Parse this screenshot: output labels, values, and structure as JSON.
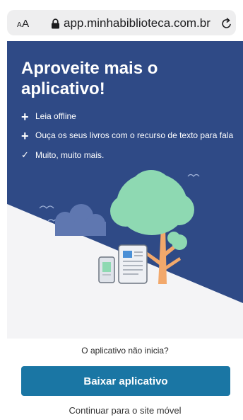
{
  "browser": {
    "text_size_label_small": "A",
    "text_size_label_large": "A",
    "url": "app.minhabiblioteca.com.br",
    "icons": [
      "text-size-icon",
      "lock-icon",
      "reload-icon"
    ]
  },
  "banner": {
    "headline": "Aproveite mais o aplicativo!",
    "features": [
      {
        "icon": "plus-icon",
        "glyph": "+",
        "text": "Leia offline"
      },
      {
        "icon": "plus-icon",
        "glyph": "+",
        "text": "Ouça os seus livros com o recurso de texto para fala"
      },
      {
        "icon": "check-icon",
        "glyph": "✓",
        "text": "Muito, muito mais."
      }
    ],
    "colors": {
      "background_dark": "#2f4a86",
      "background_light": "#f3f3f5",
      "tree_green": "#8ed9b2",
      "trunk_orange": "#f2a86b",
      "cloud_blue": "#5f77b0"
    }
  },
  "actions": {
    "trouble_text": "O aplicativo não inicia?",
    "download_label": "Baixar aplicativo",
    "continue_label": "Continuar para o site móvel",
    "accent_color": "#1a76a4"
  }
}
